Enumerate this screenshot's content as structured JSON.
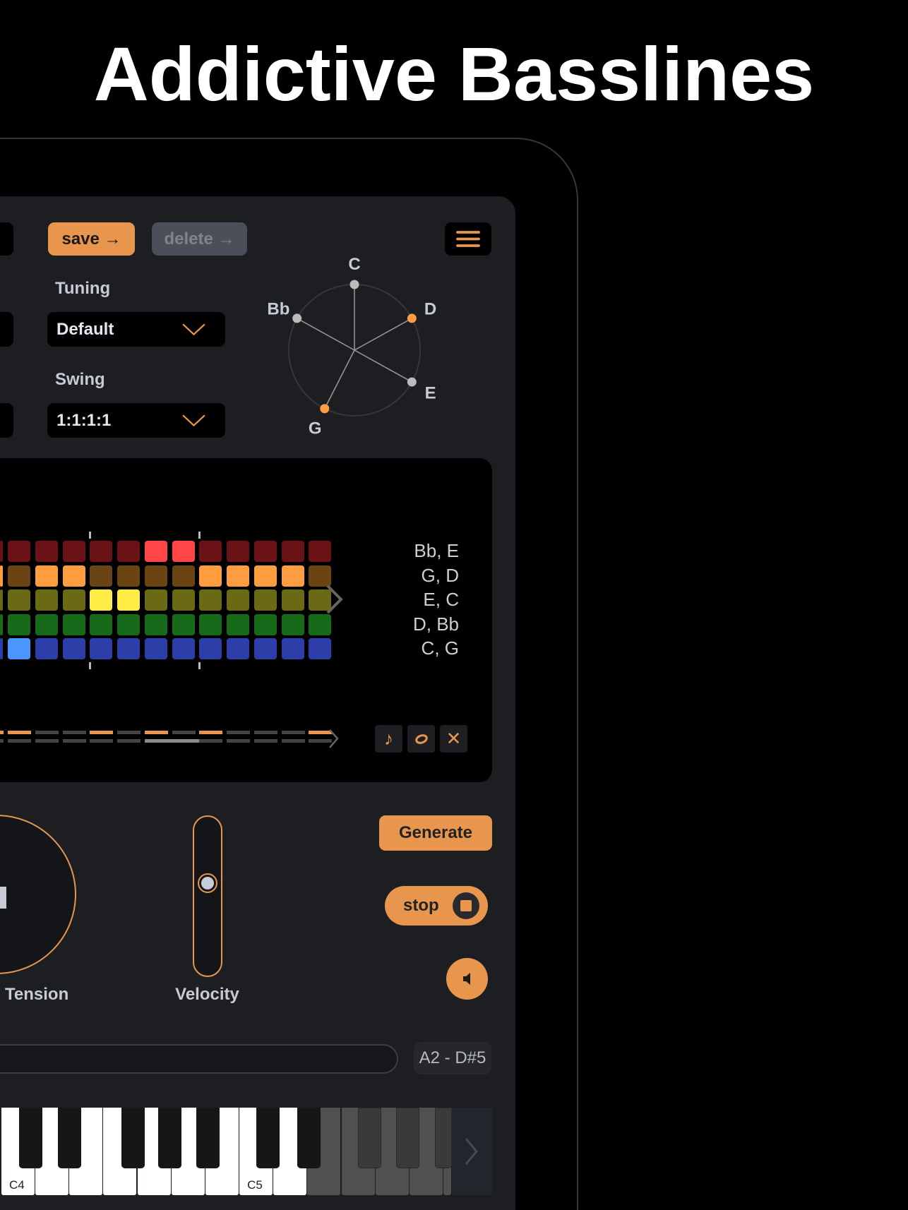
{
  "title": "Addictive Basslines",
  "toolbar": {
    "save_label": "save →",
    "delete_label": "delete →"
  },
  "tuning": {
    "label": "Tuning",
    "value": "Default"
  },
  "swing": {
    "label": "Swing",
    "value": "1:1:1:1"
  },
  "radar": {
    "notes": [
      {
        "name": "C",
        "active": false,
        "angle_deg": 0
      },
      {
        "name": "D",
        "active": true,
        "angle_deg": 61
      },
      {
        "name": "E",
        "active": false,
        "angle_deg": 119
      },
      {
        "name": "G",
        "active": true,
        "angle_deg": 207
      },
      {
        "name": "Bb",
        "active": false,
        "angle_deg": 299
      }
    ]
  },
  "grid": {
    "rows": [
      {
        "label": "Bb, E",
        "dim": "#6b1217",
        "bright": "#ff4545",
        "active": [
          5,
          6
        ]
      },
      {
        "label": "G, D",
        "dim": "#6b4414",
        "bright": "#ff9c40",
        "active": [
          -1,
          1,
          2,
          7,
          8,
          9,
          10
        ]
      },
      {
        "label": "E, C",
        "dim": "#6a6a14",
        "bright": "#ffec44",
        "active": [
          3,
          4
        ]
      },
      {
        "label": "D, Bb",
        "dim": "#176a1a",
        "bright": "#2ea82e",
        "active": []
      },
      {
        "label": "C, G",
        "dim": "#2e3ea8",
        "bright": "#4a95ff",
        "active": [
          0
        ]
      }
    ],
    "steps_top_active": [
      -1,
      0,
      3,
      5,
      7,
      11
    ],
    "steps_bottom_highlight": [
      5,
      6
    ]
  },
  "tools": {
    "note_icon": "♪",
    "rest_icon": "o",
    "clear_icon": "✕"
  },
  "knobs": {
    "tension_label": "Tension",
    "velocity_label": "Velocity",
    "velocity_value": 0.6
  },
  "actions": {
    "generate_label": "Generate",
    "stop_label": "stop"
  },
  "range": {
    "label": "A2 - D#5"
  },
  "keyboard": {
    "labels": {
      "c4": "C4",
      "c5": "C5"
    }
  },
  "colors": {
    "accent": "#e8964e",
    "panel": "#1c1e22"
  }
}
